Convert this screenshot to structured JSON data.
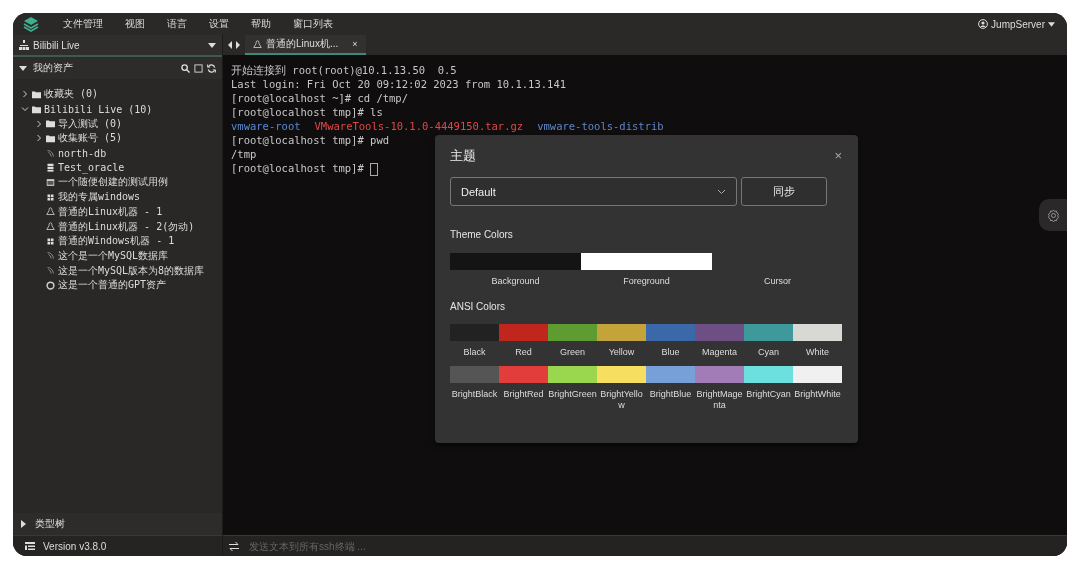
{
  "menu_bar": {
    "items": [
      "文件管理",
      "视图",
      "语言",
      "设置",
      "帮助",
      "窗口列表"
    ],
    "user": "JumpServer"
  },
  "sidebar": {
    "org": "Bilibili Live",
    "section": {
      "title": "我的资产",
      "expanded": true
    },
    "tree": [
      {
        "label": "收藏夹 (0)",
        "kind": "folder",
        "expanded": false
      },
      {
        "label": "Bilibili Live (10)",
        "kind": "folder",
        "expanded": true,
        "children": [
          {
            "label": "导入测试 (0)",
            "kind": "folder",
            "expanded": false
          },
          {
            "label": "收集账号 (5)",
            "kind": "folder",
            "expanded": false
          },
          {
            "label": "north-db",
            "kind": "mysql"
          },
          {
            "label": "Test_oracle",
            "kind": "database"
          },
          {
            "label": "一个随便创建的测试用例",
            "kind": "web"
          },
          {
            "label": "我的专属windows",
            "kind": "windows"
          },
          {
            "label": "普通的Linux机器 - 1",
            "kind": "linux"
          },
          {
            "label": "普通的Linux机器 - 2(勿动)",
            "kind": "linux"
          },
          {
            "label": "普通的Windows机器 - 1",
            "kind": "windows"
          },
          {
            "label": "这个是一个MySQL数据库",
            "kind": "mysql"
          },
          {
            "label": "这是一个MySQL版本为8的数据库",
            "kind": "mysql"
          },
          {
            "label": "这是一个普通的GPT资产",
            "kind": "gpt"
          }
        ]
      }
    ],
    "footer_section": {
      "title": "类型树",
      "expanded": false
    },
    "version": "Version v3.8.0"
  },
  "tabs": [
    {
      "label": "普通的Linux机...",
      "selected": true,
      "close": "×"
    }
  ],
  "terminal": {
    "lines": [
      [
        {
          "text": "开始连接到 root(root)@10.1.13.50  0.5",
          "color": "#c8c8c8"
        }
      ],
      [
        {
          "text": "Last login: Fri Oct 20 09:12:02 2023 from 10.1.13.141",
          "color": "#c8c8c8"
        }
      ],
      [
        {
          "text": "[root@localhost ~]# cd /tmp/",
          "color": "#c8c8c8"
        }
      ],
      [
        {
          "text": "[root@localhost tmp]# ls",
          "color": "#c8c8c8"
        }
      ],
      [
        {
          "text": "vmware-root",
          "color": "#5a8ad6"
        },
        {
          "text": "VMwareTools-10.1.0-4449150.tar.gz",
          "color": "#e04848"
        },
        {
          "text": "vmware-tools-distrib",
          "color": "#5f86c8"
        }
      ],
      [
        {
          "text": "[root@localhost tmp]# pwd",
          "color": "#c8c8c8"
        }
      ],
      [
        {
          "text": "/tmp",
          "color": "#c8c8c8"
        }
      ],
      [
        {
          "text": "[root@localhost tmp]# ",
          "color": "#c8c8c8"
        }
      ]
    ],
    "cursor": true,
    "input_placeholder": "发送文本到所有ssh终端 ..."
  },
  "theme_dialog": {
    "title": "主题",
    "close": "×",
    "theme": "Default",
    "sync_button": "同步",
    "theme_colors_title": "Theme Colors",
    "theme_colors": [
      {
        "label": "Background",
        "color": "#141414"
      },
      {
        "label": "Foreground",
        "color": "#ffffff"
      },
      {
        "label": "Cursor"
      }
    ],
    "ansi_title": "ANSI Colors",
    "ansi_colors": [
      {
        "label": "Black",
        "color": "#222222"
      },
      {
        "label": "Red",
        "color": "#c0261e"
      },
      {
        "label": "Green",
        "color": "#5e9b30"
      },
      {
        "label": "Yellow",
        "color": "#c4a33a"
      },
      {
        "label": "Blue",
        "color": "#3b68a8"
      },
      {
        "label": "Magenta",
        "color": "#6e4f84"
      },
      {
        "label": "Cyan",
        "color": "#3e9a9a"
      },
      {
        "label": "White",
        "color": "#d8d8d4"
      }
    ],
    "ansi_bright_colors": [
      {
        "label": "BrightBlack",
        "color": "#555555"
      },
      {
        "label": "BrightRed",
        "color": "#e23d3a"
      },
      {
        "label": "BrightGreen",
        "color": "#9ad64e"
      },
      {
        "label": "BrightYellow",
        "color": "#f5de60"
      },
      {
        "label": "BrightBlue",
        "color": "#78a0d8"
      },
      {
        "label": "BrightMagenta",
        "color": "#a27cb6"
      },
      {
        "label": "BrightCyan",
        "color": "#6be0de"
      },
      {
        "label": "BrightWhite",
        "color": "#f0f0f0"
      }
    ]
  }
}
